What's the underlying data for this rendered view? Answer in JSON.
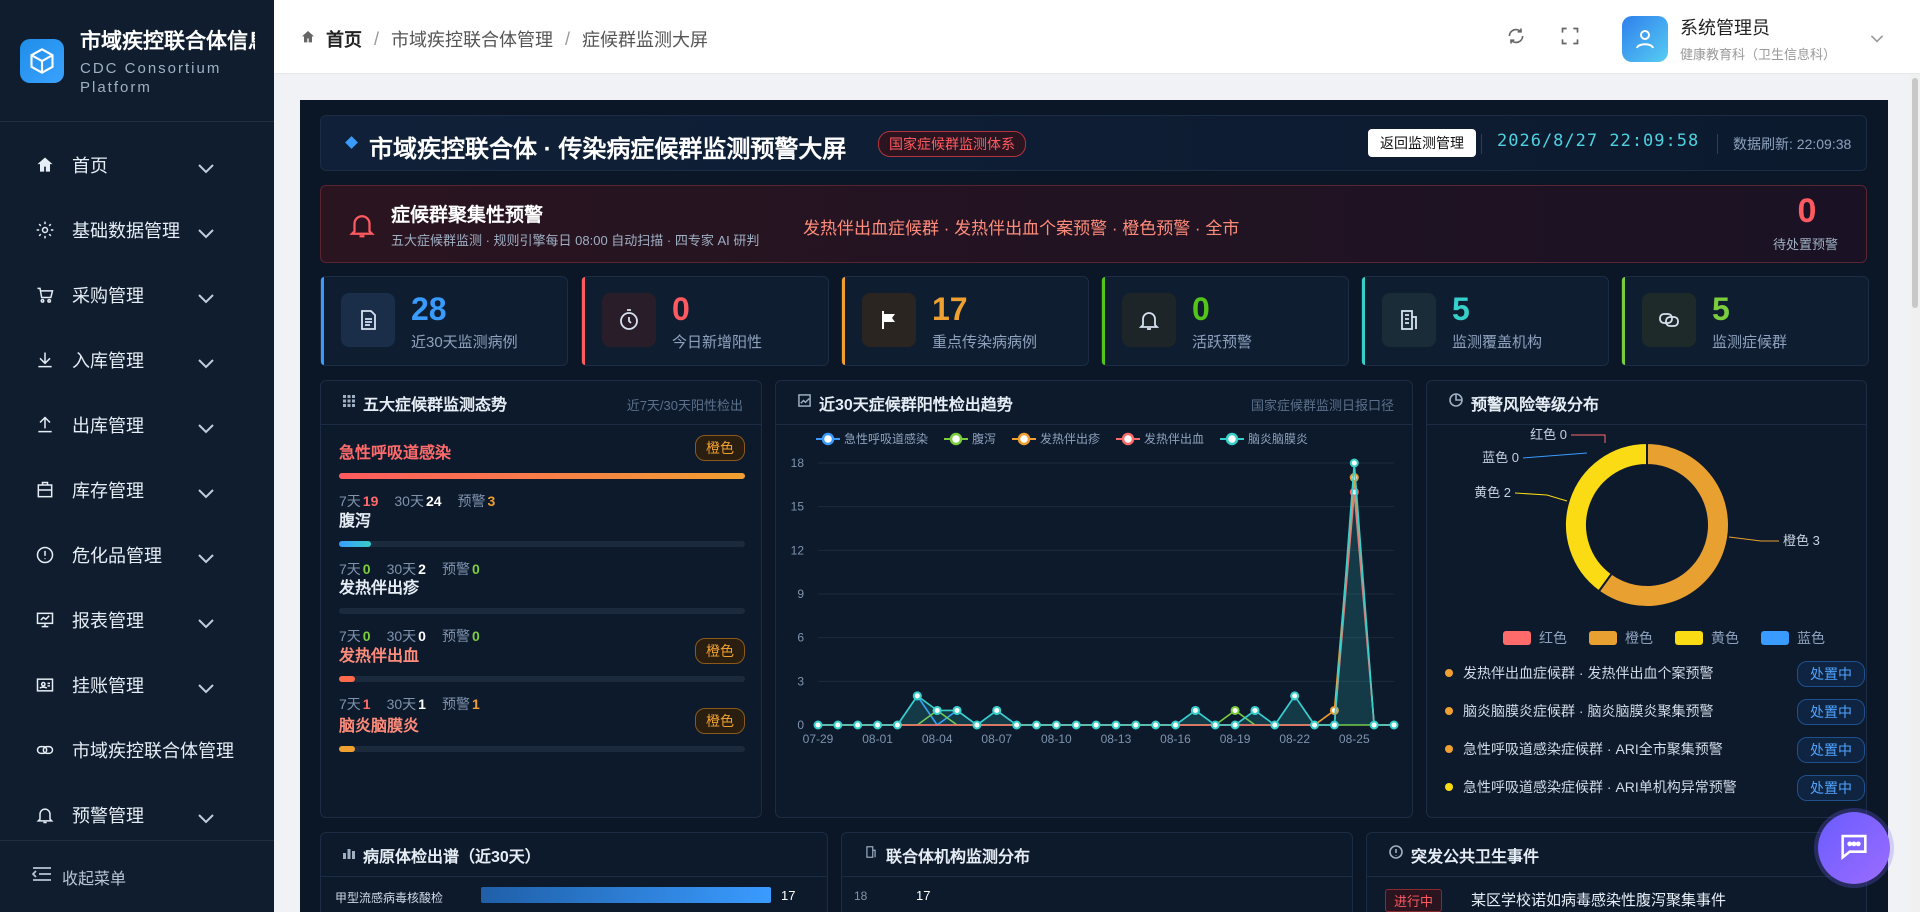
{
  "sidebar": {
    "logo_title": "市域疾控联合体信息化",
    "logo_sub1": "CDC Consortium",
    "logo_sub2": "Platform",
    "items": [
      {
        "label": "首页"
      },
      {
        "label": "基础数据管理"
      },
      {
        "label": "采购管理"
      },
      {
        "label": "入库管理"
      },
      {
        "label": "出库管理"
      },
      {
        "label": "库存管理"
      },
      {
        "label": "危化品管理"
      },
      {
        "label": "报表管理"
      },
      {
        "label": "挂账管理"
      },
      {
        "label": "市域疾控联合体管理"
      },
      {
        "label": "预警管理"
      }
    ],
    "collapse_label": "收起菜单"
  },
  "header": {
    "breadcrumb": [
      "首页",
      "市域疾控联合体管理",
      "症候群监测大屏"
    ],
    "user_name": "系统管理员",
    "user_role": "健康教育科（卫生信息科）"
  },
  "dashboard": {
    "title": "市域疾控联合体 · 传染病症候群监测预警大屏",
    "badge": "国家症候群监测体系",
    "back_button": "返回监测管理",
    "datetime": "2026/8/27 22:09:58",
    "refresh": "数据刷新: 22:09:38"
  },
  "alert": {
    "title": "症候群聚集性预警",
    "subtitle": "五大症候群监测 · 规则引擎每日 08:00 自动扫描 · 四专家 AI 研判",
    "message": "发热伴出血症候群 · 发热伴出血个案预警 · 橙色预警 · 全市",
    "count": "0",
    "count_label": "待处置预警"
  },
  "stats": [
    {
      "value": "28",
      "label": "近30天监测病例",
      "color": "#3a9bff"
    },
    {
      "value": "0",
      "label": "今日新增阳性",
      "color": "#ff5a5f"
    },
    {
      "value": "17",
      "label": "重点传染病病例",
      "color": "#f0a030"
    },
    {
      "value": "0",
      "label": "活跃预警",
      "color": "#52c41a"
    },
    {
      "value": "5",
      "label": "监测覆盖机构",
      "color": "#36cfc9"
    },
    {
      "value": "5",
      "label": "监测症候群",
      "color": "#7ccd3e"
    }
  ],
  "syndromes": {
    "title": "五大症候群监测态势",
    "range": "近7天/30天阳性检出",
    "d7": "7天",
    "d30": "30天",
    "warn": "预警",
    "items": [
      {
        "name": "急性呼吸道感染",
        "tag": "橙色",
        "d7": "19",
        "d30": "24",
        "warn": "3",
        "fill": 1.0
      },
      {
        "name": "腹泻",
        "tag": "",
        "d7": "0",
        "d30": "2",
        "warn": "0",
        "fill": 0.08
      },
      {
        "name": "发热伴出疹",
        "tag": "",
        "d7": "0",
        "d30": "0",
        "warn": "0",
        "fill": 0
      },
      {
        "name": "发热伴出血",
        "tag": "橙色",
        "d7": "1",
        "d30": "1",
        "warn": "1",
        "fill": 0.04
      },
      {
        "name": "脑炎脑膜炎",
        "tag": "橙色",
        "d7": "",
        "d30": "",
        "warn": "",
        "fill": 0.04
      }
    ]
  },
  "trend": {
    "title": "近30天症候群阳性检出趋势",
    "source": "国家症候群监测日报口径"
  },
  "risk": {
    "title": "预警风险等级分布",
    "labels": {
      "red": "红色 0",
      "blue": "蓝色 0",
      "yellow": "黄色 2",
      "orange": "橙色 3"
    },
    "legend": [
      "红色",
      "橙色",
      "黄色",
      "蓝色"
    ],
    "warnings": [
      {
        "text": "发热伴出血症候群 · 发热伴出血个案预警",
        "status": "处置中",
        "dot": "#f0a030"
      },
      {
        "text": "脑炎脑膜炎症候群 · 脑炎脑膜炎聚集预警",
        "status": "处置中",
        "dot": "#f0a030"
      },
      {
        "text": "急性呼吸道感染症候群 · ARI全市聚集预警",
        "status": "处置中",
        "dot": "#f0a030"
      },
      {
        "text": "急性呼吸道感染症候群 · ARI单机构异常预警",
        "status": "处置中",
        "dot": "#fadb14"
      }
    ]
  },
  "bottom": {
    "pathogen_title": "病原体检出谱（近30天）",
    "pathogen_first": "甲型流感病毒核酸检",
    "pathogen_first_value": "17",
    "org_title": "联合体机构监测分布",
    "org_axis_top": "18",
    "org_first_value": "17",
    "event_title": "突发公共卫生事件",
    "event_status": "进行中",
    "event_first": "某区学校诺如病毒感染性腹泻聚集事件"
  },
  "chart_data": {
    "type": "line",
    "title": "近30天症候群阳性检出趋势",
    "x": [
      "07-29",
      "07-30",
      "07-31",
      "08-01",
      "08-02",
      "08-03",
      "08-04",
      "08-05",
      "08-06",
      "08-07",
      "08-08",
      "08-09",
      "08-10",
      "08-11",
      "08-12",
      "08-13",
      "08-14",
      "08-15",
      "08-16",
      "08-17",
      "08-18",
      "08-19",
      "08-20",
      "08-21",
      "08-22",
      "08-23",
      "08-24",
      "08-25",
      "08-26",
      "08-27"
    ],
    "xticks": [
      "07-29",
      "08-01",
      "08-04",
      "08-07",
      "08-10",
      "08-13",
      "08-16",
      "08-19",
      "08-22",
      "08-25"
    ],
    "ylim": [
      0,
      18
    ],
    "yticks": [
      0,
      3,
      6,
      9,
      12,
      15,
      18
    ],
    "series": [
      {
        "name": "急性呼吸道感染",
        "color": "#3a9bff",
        "values": [
          0,
          0,
          0,
          0,
          0,
          2,
          0,
          1,
          0,
          1,
          0,
          0,
          0,
          0,
          0,
          0,
          0,
          0,
          0,
          1,
          0,
          0,
          1,
          0,
          2,
          0,
          0,
          17,
          0,
          0
        ]
      },
      {
        "name": "腹泻",
        "color": "#7ccd3e",
        "values": [
          0,
          0,
          0,
          0,
          0,
          0,
          1,
          0,
          0,
          0,
          0,
          0,
          0,
          0,
          0,
          0,
          0,
          0,
          0,
          0,
          0,
          1,
          0,
          0,
          0,
          0,
          0,
          0,
          0,
          0
        ]
      },
      {
        "name": "发热伴出疹",
        "color": "#f0a030",
        "values": [
          0,
          0,
          0,
          0,
          0,
          0,
          0,
          0,
          0,
          0,
          0,
          0,
          0,
          0,
          0,
          0,
          0,
          0,
          0,
          0,
          0,
          0,
          0,
          0,
          0,
          0,
          1,
          17,
          0,
          0
        ]
      },
      {
        "name": "发热伴出血",
        "color": "#ff6b6b",
        "values": [
          0,
          0,
          0,
          0,
          0,
          0,
          0,
          0,
          0,
          0,
          0,
          0,
          0,
          0,
          0,
          0,
          0,
          0,
          0,
          0,
          0,
          0,
          0,
          0,
          0,
          0,
          0,
          16,
          0,
          0
        ]
      },
      {
        "name": "脑炎脑膜炎",
        "color": "#36cfc9",
        "values": [
          0,
          0,
          0,
          0,
          0,
          2,
          1,
          1,
          0,
          1,
          0,
          0,
          0,
          0,
          0,
          0,
          0,
          0,
          0,
          1,
          0,
          0,
          1,
          0,
          2,
          0,
          0,
          18,
          0,
          0
        ]
      }
    ]
  },
  "risk_chart": {
    "type": "pie",
    "categories": [
      "红色",
      "橙色",
      "黄色",
      "蓝色"
    ],
    "values": [
      0,
      3,
      2,
      0
    ],
    "colors": [
      "#ff6b6b",
      "#e8a030",
      "#fadb14",
      "#3a9bff"
    ]
  }
}
